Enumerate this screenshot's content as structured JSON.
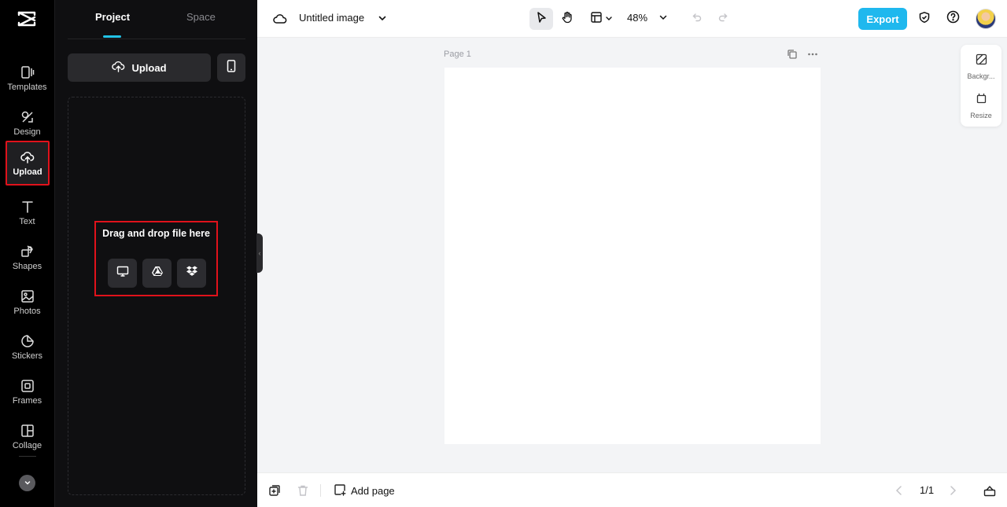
{
  "rail": {
    "items": [
      {
        "label": "Templates",
        "icon": "templates-icon"
      },
      {
        "label": "Design",
        "icon": "design-icon"
      },
      {
        "label": "Upload",
        "icon": "upload-cloud-icon"
      },
      {
        "label": "Text",
        "icon": "text-icon"
      },
      {
        "label": "Shapes",
        "icon": "shapes-icon"
      },
      {
        "label": "Photos",
        "icon": "photos-icon"
      },
      {
        "label": "Stickers",
        "icon": "stickers-icon"
      },
      {
        "label": "Frames",
        "icon": "frames-icon"
      },
      {
        "label": "Collage",
        "icon": "collage-icon"
      }
    ],
    "active": "Upload"
  },
  "panel": {
    "tabs": [
      {
        "label": "Project"
      },
      {
        "label": "Space"
      }
    ],
    "upload_label": "Upload",
    "drop_text": "Drag and drop file here",
    "sources": [
      "computer-icon",
      "google-drive-icon",
      "dropbox-icon"
    ]
  },
  "topbar": {
    "title": "Untitled image",
    "zoom": "48%",
    "export_label": "Export"
  },
  "canvas": {
    "page_label": "Page 1"
  },
  "right_tools": [
    {
      "label": "Backgr...",
      "icon": "background-icon"
    },
    {
      "label": "Resize",
      "icon": "resize-icon"
    }
  ],
  "bottombar": {
    "add_page_label": "Add page",
    "page_count": "1/1"
  },
  "colors": {
    "accent": "#1fb8ee",
    "highlight": "#e0121b",
    "tab_underline": "#22c3e6"
  }
}
